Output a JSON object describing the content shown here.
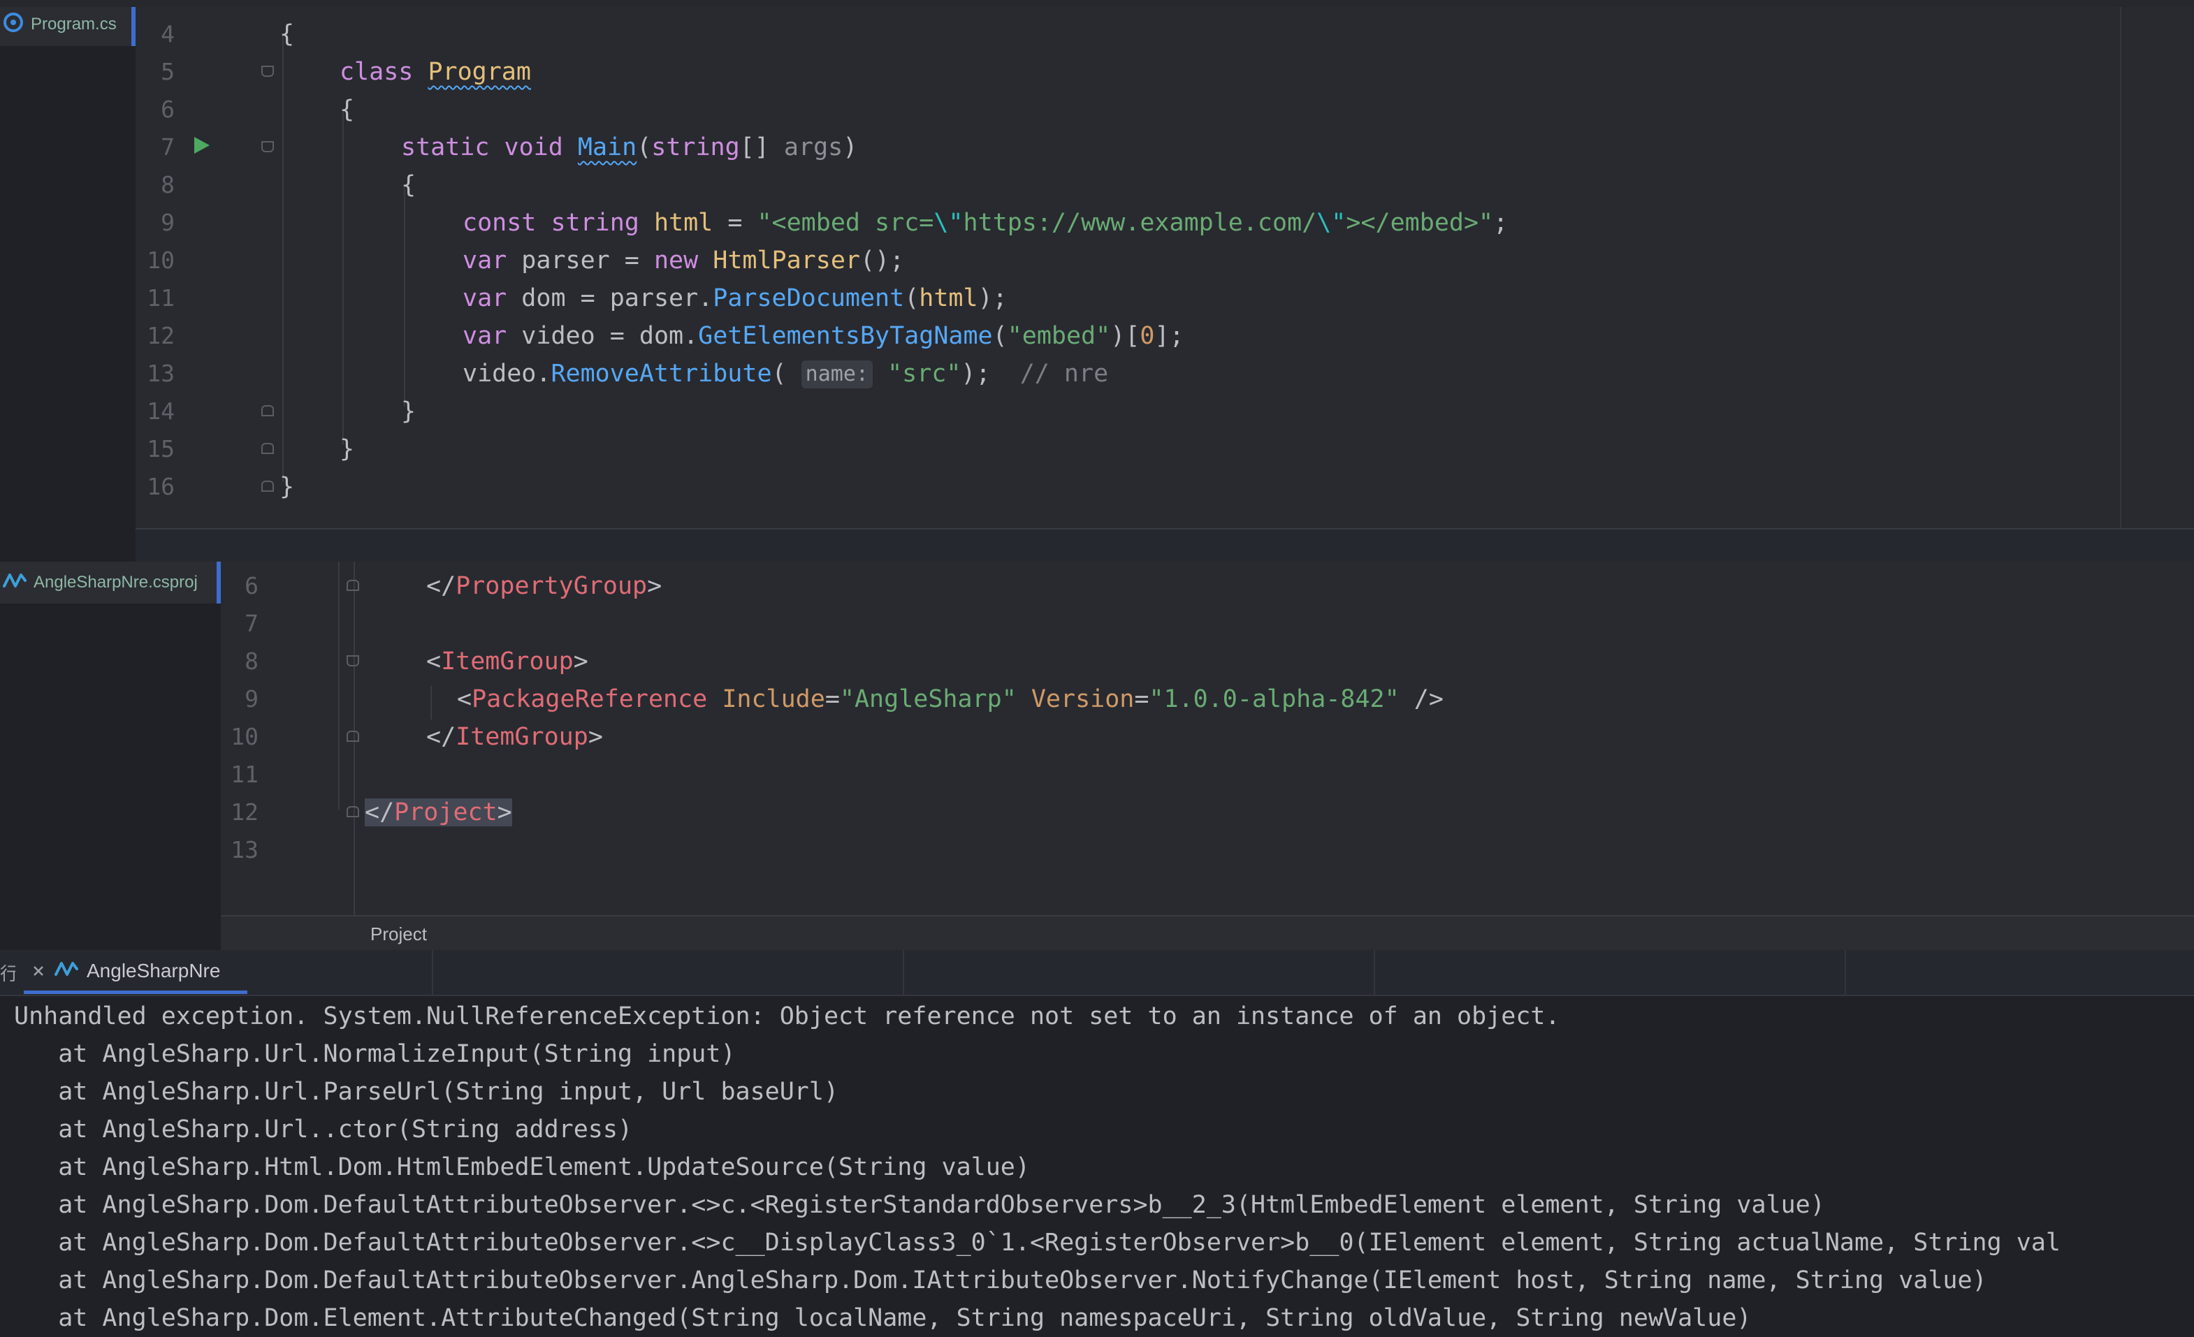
{
  "top_editor": {
    "tab_label": "Program.cs",
    "line_numbers": [
      "4",
      "5",
      "6",
      "7",
      "8",
      "9",
      "10",
      "11",
      "12",
      "13",
      "14",
      "15",
      "16"
    ]
  },
  "code": {
    "l5_kw": "class",
    "l5_name": "Program",
    "l7_static": "static",
    "l7_void": "void",
    "l7_main": "Main",
    "l7_string": "string",
    "l7_args": "args",
    "l9_const": "const",
    "l9_string": "string",
    "l9_var": "html",
    "l9_str1": "\"<embed src=",
    "l9_esc1": "\\\"",
    "l9_str2": "https://www.example.com/",
    "l9_esc2": "\\\"",
    "l9_str3": "></embed>\"",
    "l10_var": "var",
    "l10_name": "parser",
    "l10_new": "new",
    "l10_cls": "HtmlParser",
    "l11_var": "var",
    "l11_name": "dom",
    "l11_obj": "parser",
    "l11_method": "ParseDocument",
    "l11_arg": "html",
    "l12_var": "var",
    "l12_name": "video",
    "l12_obj": "dom",
    "l12_method": "GetElementsByTagName",
    "l12_str": "\"embed\"",
    "l12_index": "0",
    "l13_obj": "video",
    "l13_method": "RemoveAttribute",
    "l13_hint": "name:",
    "l13_str": "\"src\"",
    "l13_comment": "// nre"
  },
  "mid_editor": {
    "tab_label": "AngleSharpNre.csproj",
    "line_numbers": [
      "6",
      "7",
      "8",
      "9",
      "10",
      "11",
      "12",
      "13"
    ],
    "l6_tag": "PropertyGroup",
    "l8_tag": "ItemGroup",
    "l9_tag": "PackageReference",
    "l9_attr1": "Include",
    "l9_val1": "\"AngleSharp\"",
    "l9_attr2": "Version",
    "l9_val2": "\"1.0.0-alpha-842\"",
    "l10_tag": "ItemGroup",
    "l12_tag": "Project",
    "breadcrumb": "Project"
  },
  "run_panel": {
    "label_prefix": "行:",
    "tab_label": "AngleSharpNre",
    "output": [
      "Unhandled exception. System.NullReferenceException: Object reference not set to an instance of an object.",
      "   at AngleSharp.Url.NormalizeInput(String input)",
      "   at AngleSharp.Url.ParseUrl(String input, Url baseUrl)",
      "   at AngleSharp.Url..ctor(String address)",
      "   at AngleSharp.Html.Dom.HtmlEmbedElement.UpdateSource(String value)",
      "   at AngleSharp.Dom.DefaultAttributeObserver.<>c.<RegisterStandardObservers>b__2_3(HtmlEmbedElement element, String value)",
      "   at AngleSharp.Dom.DefaultAttributeObserver.<>c__DisplayClass3_0`1.<RegisterObserver>b__0(IElement element, String actualName, String val",
      "   at AngleSharp.Dom.DefaultAttributeObserver.AngleSharp.Dom.IAttributeObserver.NotifyChange(IElement host, String name, String value)",
      "   at AngleSharp.Dom.Element.AttributeChanged(String localName, String namespaceUri, String oldValue, String newValue)"
    ]
  }
}
